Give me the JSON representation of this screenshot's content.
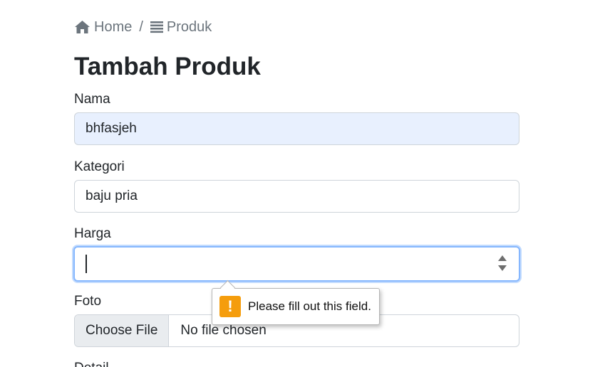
{
  "breadcrumb": {
    "home_label": "Home",
    "separator": "/",
    "produk_label": "Produk"
  },
  "page_title": "Tambah Produk",
  "form": {
    "nama": {
      "label": "Nama",
      "value": "bhfasjeh",
      "autofilled": true
    },
    "kategori": {
      "label": "Kategori",
      "value": "baju pria"
    },
    "harga": {
      "label": "Harga",
      "value": "",
      "focused": true
    },
    "foto": {
      "label": "Foto",
      "button_label": "Choose File",
      "status": "No file chosen"
    },
    "detail": {
      "label": "Detail"
    }
  },
  "validation_tooltip": {
    "icon": "warning-icon",
    "icon_glyph": "!",
    "message": "Please fill out this field."
  },
  "colors": {
    "autofill_bg": "#e8f0fe",
    "focus_border": "#86b7fe",
    "warning": "#f59d0d",
    "muted": "#6c757d"
  }
}
